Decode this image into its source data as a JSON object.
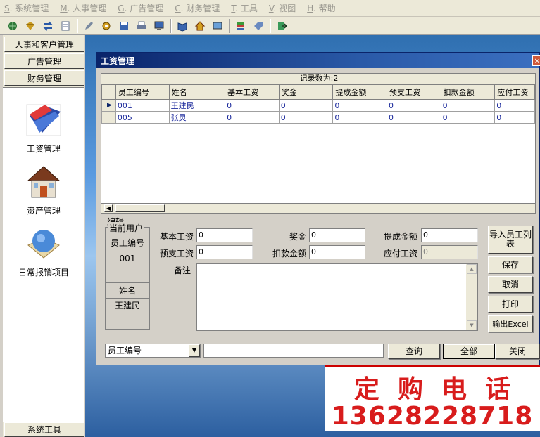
{
  "menu": [
    {
      "key": "S",
      "label": "系统管理"
    },
    {
      "key": "M",
      "label": "人事管理"
    },
    {
      "key": "G",
      "label": "广告管理"
    },
    {
      "key": "C",
      "label": "财务管理"
    },
    {
      "key": "T",
      "label": "工具"
    },
    {
      "key": "V",
      "label": "视图"
    },
    {
      "key": "H",
      "label": "帮助"
    }
  ],
  "toolbar": {
    "icons": [
      "globe-icon",
      "diamond-icon",
      "transfer-icon",
      "document-icon",
      "pen-icon",
      "gear-icon",
      "disk-icon",
      "print-icon",
      "monitor-icon",
      "book-icon",
      "home-icon",
      "screen-icon",
      "stack-icon",
      "tag-icon",
      "exit-icon"
    ]
  },
  "sidebar": {
    "sections": [
      "人事和客户管理",
      "广告管理",
      "财务管理"
    ],
    "items": [
      {
        "label": "工资管理",
        "icon": "wallet-icon"
      },
      {
        "label": "资产管理",
        "icon": "house-icon"
      },
      {
        "label": "日常报销项目",
        "icon": "globe-book-icon"
      }
    ],
    "bottom": "系统工具"
  },
  "window": {
    "title": "工资管理",
    "close": "×"
  },
  "grid": {
    "record_count": "记录数为:2",
    "columns": [
      "员工编号",
      "姓名",
      "基本工资",
      "奖金",
      "提成金额",
      "预支工资",
      "扣款金额",
      "应付工资"
    ],
    "rows": [
      [
        "001",
        "王建民",
        "0",
        "0",
        "0",
        "0",
        "0",
        "0"
      ],
      [
        "005",
        "张灵",
        "0",
        "0",
        "0",
        "0",
        "0",
        "0"
      ]
    ],
    "current_row_marker": "▶"
  },
  "edit": {
    "group_label": "编辑",
    "current_user_label": "当前用户",
    "emp_no_label": "员工编号",
    "emp_no_value": "001",
    "name_label": "姓名",
    "name_value": "王建民",
    "fields": {
      "base_salary": {
        "label": "基本工资",
        "value": "0"
      },
      "bonus": {
        "label": "奖金",
        "value": "0"
      },
      "commission": {
        "label": "提成金额",
        "value": "0"
      },
      "advance": {
        "label": "预支工资",
        "value": "0"
      },
      "deduction": {
        "label": "扣款金额",
        "value": "0"
      },
      "payable": {
        "label": "应付工资",
        "value": "0"
      }
    },
    "remark_label": "备注"
  },
  "buttons": {
    "import": "导入员工列表",
    "save": "保存",
    "cancel": "取消",
    "print": "打印",
    "export": "输出Excel",
    "query": "查询",
    "all": "全部",
    "close": "关闭"
  },
  "search": {
    "field_select": "员工编号",
    "query_value": ""
  },
  "ad": {
    "line1": "定购电话",
    "line2": "13628228718"
  }
}
